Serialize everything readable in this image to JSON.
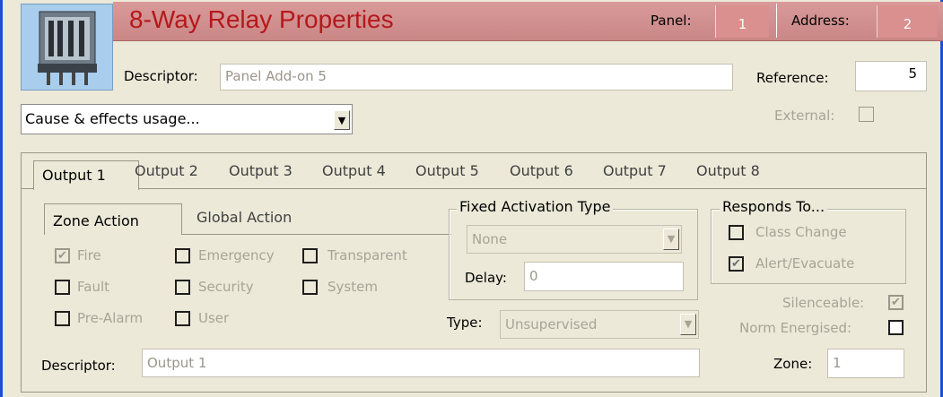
{
  "header": {
    "title": "8-Way Relay Properties",
    "panel_label": "Panel:",
    "panel_value": "1",
    "address_label": "Address:",
    "address_value": "2"
  },
  "descriptor": {
    "label": "Descriptor:",
    "value": "Panel Add-on 5"
  },
  "reference": {
    "label": "Reference:",
    "value": "5"
  },
  "cause_effects": {
    "selected": "Cause & effects usage..."
  },
  "external": {
    "label": "External:",
    "checked": false
  },
  "output_tabs": [
    "Output 1",
    "Output 2",
    "Output 3",
    "Output 4",
    "Output 5",
    "Output 6",
    "Output 7",
    "Output 8"
  ],
  "zone_tabs": [
    "Zone Action",
    "Global Action"
  ],
  "zone_checks": {
    "fire": "Fire",
    "emergency": "Emergency",
    "transparent": "Transparent",
    "fault": "Fault",
    "security": "Security",
    "system": "System",
    "pre_alarm": "Pre-Alarm",
    "user": "User"
  },
  "fixed_activation": {
    "title": "Fixed Activation Type",
    "selected": "None",
    "delay_label": "Delay:",
    "delay_value": "0"
  },
  "type": {
    "label": "Type:",
    "selected": "Unsupervised"
  },
  "responds_to": {
    "title": "Responds To...",
    "class_change": "Class Change",
    "alert_evacuate": "Alert/Evacuate"
  },
  "silenceable": {
    "label": "Silenceable:"
  },
  "norm_energised": {
    "label": "Norm Energised:"
  },
  "output_descriptor": {
    "label": "Descriptor:",
    "value": "Output 1"
  },
  "zone": {
    "label": "Zone:",
    "value": "1"
  },
  "colors": {
    "title": "#b5181b",
    "header_band": "#c98786",
    "window_border": "#1a4fd6"
  }
}
